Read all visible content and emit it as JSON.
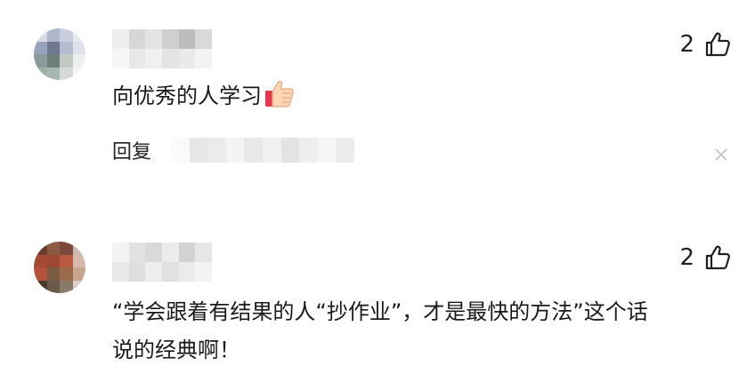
{
  "comments": [
    {
      "likes": "2",
      "text": "向优秀的人学习",
      "emoji": "thumbs-up-emoji",
      "reply_label": "回复"
    },
    {
      "likes": "2",
      "text_line1": "“学会跟着有结果的人“抄作业”，才是最快的方法”这个话",
      "text_line2": "说的经典啊！"
    }
  ],
  "icons": {
    "like": "thumbs-up-outline-icon",
    "dismiss": "close-icon"
  },
  "colors": {
    "text": "#1a1a1a",
    "muted": "#b8b8b8"
  }
}
